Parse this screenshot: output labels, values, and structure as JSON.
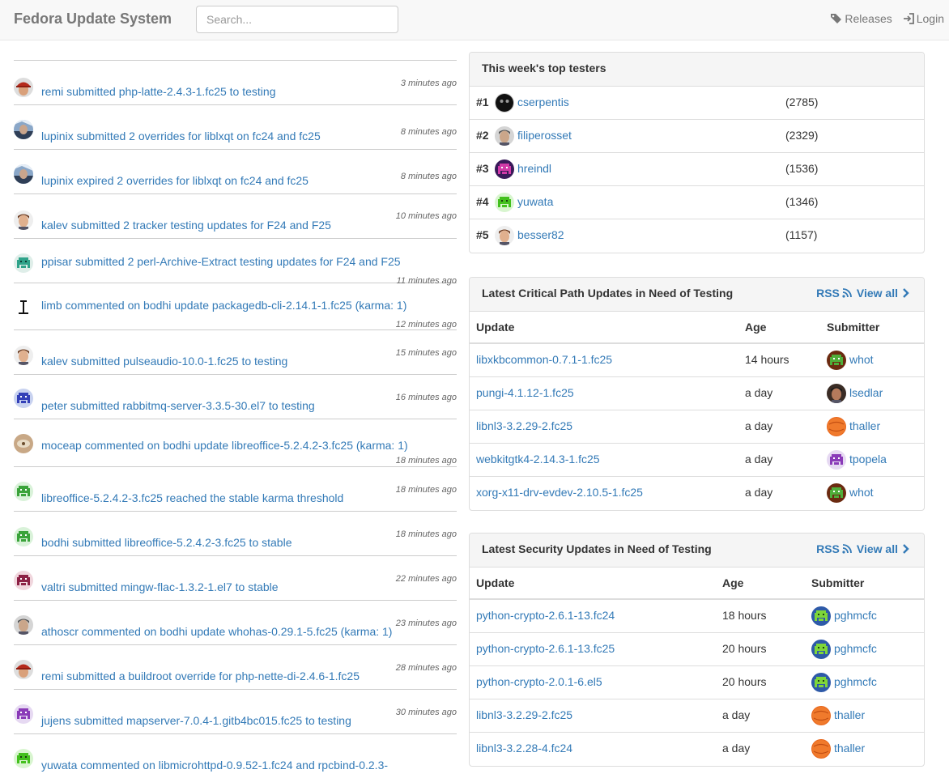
{
  "app": {
    "brand": "Fedora Update System",
    "search_placeholder": "Search...",
    "nav": {
      "releases": "Releases",
      "login": "Login"
    }
  },
  "feed": [
    {
      "text": "remi submitted php-latte-2.4.3-1.fc25 to testing",
      "time": "3 minutes ago",
      "avatar": "red-cap"
    },
    {
      "text": "lupinix submitted 2 overrides for liblxqt on fc24 and fc25",
      "time": "8 minutes ago",
      "avatar": "photo-blue"
    },
    {
      "text": "lupinix expired 2 overrides for liblxqt on fc24 and fc25",
      "time": "8 minutes ago",
      "avatar": "photo-blue"
    },
    {
      "text": "kalev submitted 2 tracker testing updates for F24 and F25",
      "time": "10 minutes ago",
      "avatar": "face"
    },
    {
      "text": "ppisar submitted 2 perl-Archive-Extract testing updates for F24 and F25",
      "time": "11 minutes ago",
      "avatar": "teal-invader"
    },
    {
      "text": "limb commented on bodhi update packagedb-cli-2.14.1-1.fc25 (karma: 1)",
      "time": "12 minutes ago",
      "avatar": "bw"
    },
    {
      "text": "kalev submitted pulseaudio-10.0-1.fc25 to testing",
      "time": "15 minutes ago",
      "avatar": "face"
    },
    {
      "text": "peter submitted rabbitmq-server-3.3.5-30.el7 to testing",
      "time": "16 minutes ago",
      "avatar": "blue-invader"
    },
    {
      "text": "moceap commented on bodhi update libreoffice-5.2.4.2-3.fc25 (karma: 1)",
      "time": "18 minutes ago",
      "avatar": "sand"
    },
    {
      "text": "libreoffice-5.2.4.2-3.fc25 reached the stable karma threshold",
      "time": "18 minutes ago",
      "avatar": "green-invader"
    },
    {
      "text": "bodhi submitted libreoffice-5.2.4.2-3.fc25 to stable",
      "time": "18 minutes ago",
      "avatar": "green-invader"
    },
    {
      "text": "valtri submitted mingw-flac-1.3.2-1.el7 to stable",
      "time": "22 minutes ago",
      "avatar": "maroon-invader"
    },
    {
      "text": "athoscr commented on bodhi update whohas-0.29.1-5.fc25 (karma: 1)",
      "time": "23 minutes ago",
      "avatar": "face-gray"
    },
    {
      "text": "remi submitted a buildroot override for php-nette-di-2.4.6-1.fc25",
      "time": "28 minutes ago",
      "avatar": "red-cap"
    },
    {
      "text": "jujens submitted mapserver-7.0.4-1.gitb4bc015.fc25 to testing",
      "time": "30 minutes ago",
      "avatar": "purple-invader"
    },
    {
      "text": "yuwata commented on libmicrohttpd-0.9.52-1.fc24 and rpcbind-0.2.3-",
      "time": "",
      "avatar": "lime-invader"
    }
  ],
  "top_testers": {
    "title": "This week's top testers",
    "rows": [
      {
        "rank": "#1",
        "name": "cserpentis",
        "count": "(2785)",
        "avatar": "black-mask"
      },
      {
        "rank": "#2",
        "name": "filiperosset",
        "count": "(2329)",
        "avatar": "face-gray"
      },
      {
        "rank": "#3",
        "name": "hreindl",
        "count": "(1536)",
        "avatar": "magenta-invader"
      },
      {
        "rank": "#4",
        "name": "yuwata",
        "count": "(1346)",
        "avatar": "lime-invader"
      },
      {
        "rank": "#5",
        "name": "besser82",
        "count": "(1157)",
        "avatar": "face"
      }
    ]
  },
  "critpath": {
    "title": "Latest Critical Path Updates in Need of Testing",
    "rss": "RSS",
    "view_all": "View all",
    "headers": {
      "update": "Update",
      "age": "Age",
      "submitter": "Submitter"
    },
    "rows": [
      {
        "update": "libxkbcommon-0.7.1-1.fc25",
        "age": "14 hours",
        "submitter": "whot",
        "avatar": "brown-invader"
      },
      {
        "update": "pungi-4.1.12-1.fc25",
        "age": "a day",
        "submitter": "lsedlar",
        "avatar": "face-dark"
      },
      {
        "update": "libnl3-3.2.29-2.fc25",
        "age": "a day",
        "submitter": "thaller",
        "avatar": "orange-ball"
      },
      {
        "update": "webkitgtk4-2.14.3-1.fc25",
        "age": "a day",
        "submitter": "tpopela",
        "avatar": "purple-invader"
      },
      {
        "update": "xorg-x11-drv-evdev-2.10.5-1.fc25",
        "age": "a day",
        "submitter": "whot",
        "avatar": "brown-invader"
      }
    ]
  },
  "security": {
    "title": "Latest Security Updates in Need of Testing",
    "rss": "RSS",
    "view_all": "View all",
    "headers": {
      "update": "Update",
      "age": "Age",
      "submitter": "Submitter"
    },
    "rows": [
      {
        "update": "python-crypto-2.6.1-13.fc24",
        "age": "18 hours",
        "submitter": "pghmcfc",
        "avatar": "lime-invader-blue"
      },
      {
        "update": "python-crypto-2.6.1-13.fc25",
        "age": "20 hours",
        "submitter": "pghmcfc",
        "avatar": "lime-invader-blue"
      },
      {
        "update": "python-crypto-2.0.1-6.el5",
        "age": "20 hours",
        "submitter": "pghmcfc",
        "avatar": "lime-invader-blue"
      },
      {
        "update": "libnl3-3.2.29-2.fc25",
        "age": "a day",
        "submitter": "thaller",
        "avatar": "orange-ball"
      },
      {
        "update": "libnl3-3.2.28-4.fc24",
        "age": "a day",
        "submitter": "thaller",
        "avatar": "orange-ball"
      }
    ]
  },
  "colors": {
    "link": "#337ab7",
    "brand": "#777777",
    "panel_heading": "#f5f5f5"
  }
}
